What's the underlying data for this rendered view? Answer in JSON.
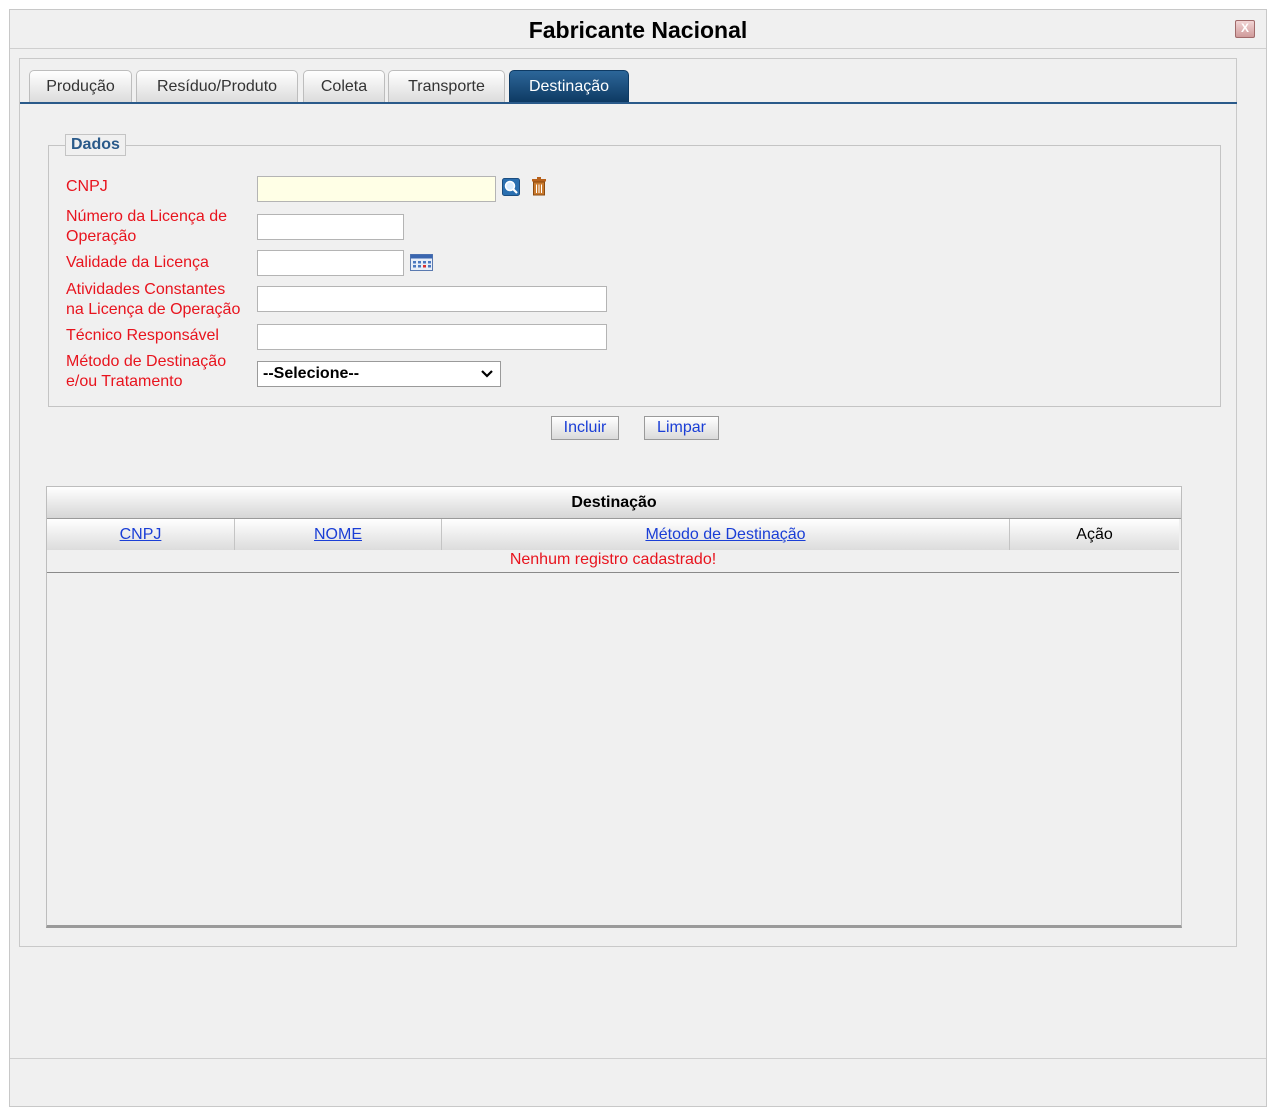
{
  "window": {
    "title": "Fabricante Nacional",
    "close_label": "X"
  },
  "tabs": [
    {
      "label": "Produção"
    },
    {
      "label": "Resíduo/Produto"
    },
    {
      "label": "Coleta"
    },
    {
      "label": "Transporte"
    },
    {
      "label": "Destinação",
      "active": true
    }
  ],
  "dados": {
    "legend": "Dados",
    "cnpj_label": "CNPJ",
    "licenca_label_1": "Número da Licença de",
    "licenca_label_2": "Operação",
    "validade_label": "Validade da Licença",
    "atividades_label_1": "Atividades Constantes",
    "atividades_label_2": "na Licença de Operação",
    "tecnico_label": "Técnico Responsável",
    "metodo_label_1": "Método de Destinação",
    "metodo_label_2": "e/ou Tratamento",
    "metodo_selected": "--Selecione--"
  },
  "actions": {
    "incluir": "Incluir",
    "limpar": "Limpar"
  },
  "grid": {
    "title": "Destinação",
    "columns": [
      "CNPJ",
      "NOME",
      "Método de Destinação",
      "Ação"
    ],
    "empty_message": "Nenhum registro cadastrado!"
  },
  "colors": {
    "accent": "#2a5a8a",
    "label_red": "#e8141e",
    "link_blue": "#1a3ed6"
  },
  "icons": {
    "search": "search-icon",
    "trash": "trash-icon",
    "calendar": "calendar-icon",
    "dropdown": "chevron-down-icon"
  }
}
